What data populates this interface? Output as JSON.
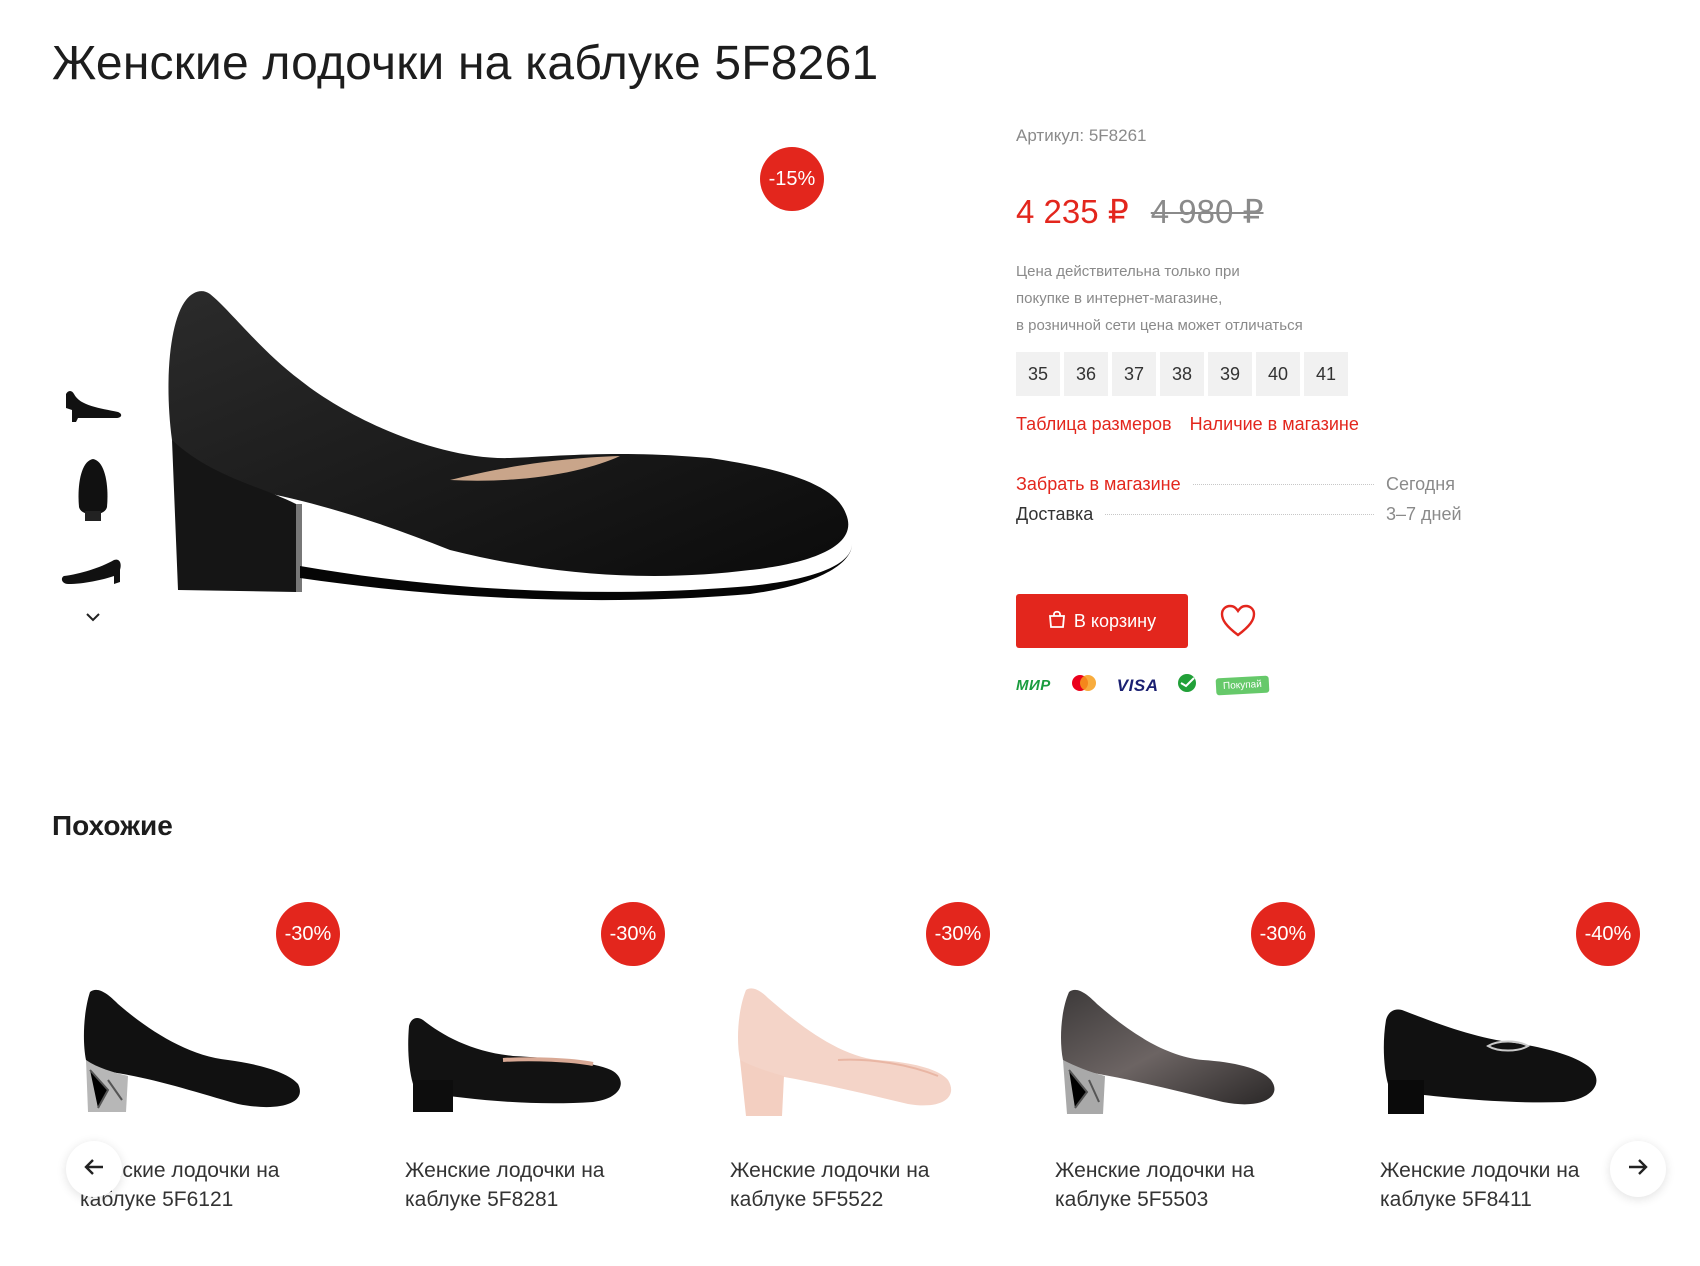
{
  "product": {
    "title": "Женские лодочки на каблуке 5F8261",
    "discount": "-15%",
    "sku": "Артикул: 5F8261",
    "price_new": "4 235 ₽",
    "price_old": "4 980 ₽",
    "note_lines": [
      "Цена действительна только при",
      "покупке в интернет-магазине,",
      "в розничной сети цена может отличаться"
    ],
    "sizes": [
      "35",
      "36",
      "37",
      "38",
      "39",
      "40",
      "41"
    ],
    "size_table_link": "Таблица размеров",
    "store_availability_link": "Наличие в магазине",
    "delivery": [
      {
        "label": "Забрать в магазине",
        "value": "Сегодня"
      },
      {
        "label": "Доставка",
        "value": "3–7 дней"
      }
    ],
    "cart_button": "В корзину",
    "payments": {
      "mir": "МИР",
      "visa": "VISA",
      "pokupay": "Покупай"
    }
  },
  "similar": {
    "title": "Похожие",
    "items": [
      {
        "name": "Женские лодочки на каблуке 5F6121",
        "discount": "-30%"
      },
      {
        "name": "Женские лодочки на каблуке 5F8281",
        "discount": "-30%"
      },
      {
        "name": "Женские лодочки на каблуке 5F5522",
        "discount": "-30%"
      },
      {
        "name": "Женские лодочки на каблуке 5F5503",
        "discount": "-30%"
      },
      {
        "name": "Женские лодочки на каблуке 5F8411",
        "discount": "-40%"
      }
    ]
  },
  "colors": {
    "accent": "#e3261d",
    "muted": "#8a8a8a",
    "size_bg": "#f1f1f1"
  },
  "icons": {
    "cart": "shopping-bag-icon",
    "favorite": "heart-icon",
    "thumbs_down": "chevron-down-icon",
    "prev": "arrow-left-icon",
    "next": "arrow-right-icon"
  }
}
